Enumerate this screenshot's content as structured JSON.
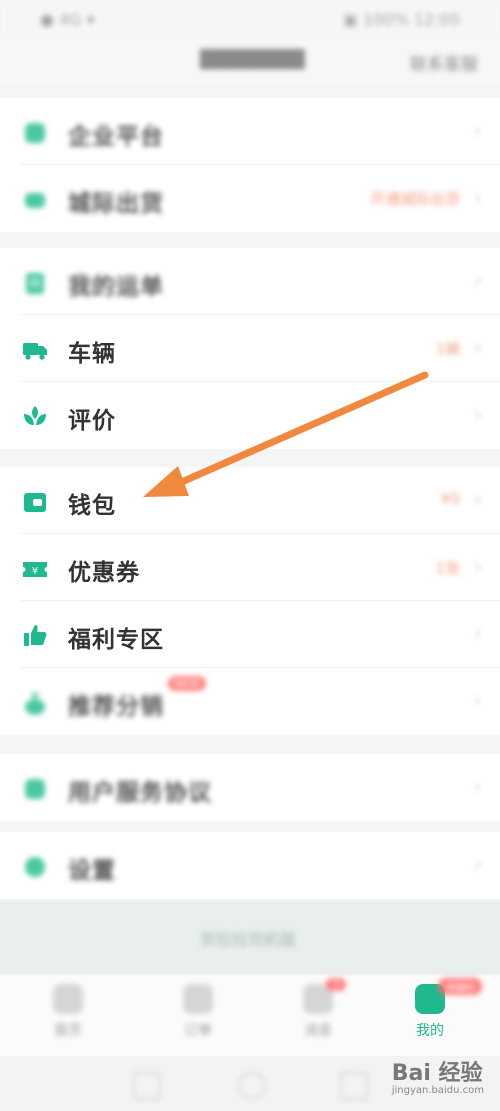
{
  "status_bar": {
    "left": "● 4G ▾",
    "right": "▣ 100% 12:00"
  },
  "header": {
    "title": "████████",
    "right_action": "联系客服"
  },
  "sections": [
    [
      {
        "id": "enterprise",
        "label": "企业平台",
        "value": "",
        "icon": "shield-icon",
        "blurred": true
      },
      {
        "id": "city",
        "label": "城际出货",
        "value": "开通城际出货",
        "icon": "city-icon",
        "blurred": true
      }
    ],
    [
      {
        "id": "orders",
        "label": "我的运单",
        "value": "",
        "icon": "clipboard-icon",
        "blurred": true
      },
      {
        "id": "vehicle",
        "label": "车辆",
        "value": "1辆",
        "icon": "truck-icon",
        "blurred": false
      },
      {
        "id": "review",
        "label": "评价",
        "value": "",
        "icon": "leaf-icon",
        "blurred": false
      }
    ],
    [
      {
        "id": "wallet",
        "label": "钱包",
        "value": "¥0",
        "icon": "wallet-icon",
        "blurred": false
      },
      {
        "id": "coupon",
        "label": "优惠券",
        "value": "1张",
        "icon": "coupon-icon",
        "blurred": false
      },
      {
        "id": "welfare",
        "label": "福利专区",
        "value": "",
        "icon": "thumbs-up-icon",
        "blurred": false
      },
      {
        "id": "referral",
        "label": "推荐分销",
        "value": "",
        "icon": "money-bag-icon",
        "blurred": true,
        "badge": "NEW"
      }
    ],
    [
      {
        "id": "safety",
        "label": "用户服务协议",
        "value": "",
        "icon": "doc-icon",
        "blurred": true
      }
    ],
    [
      {
        "id": "settings",
        "label": "设置",
        "value": "",
        "icon": "gear-icon",
        "blurred": true
      }
    ]
  ],
  "promo_text": "货拉拉司机版",
  "tabs": [
    {
      "label": "首页",
      "active": false,
      "icon": "home-icon"
    },
    {
      "label": "订单",
      "active": false,
      "icon": "order-icon"
    },
    {
      "label": "消息",
      "active": false,
      "icon": "message-icon",
      "badge": "3"
    },
    {
      "label": "我的",
      "active": true,
      "icon": "profile-icon",
      "badge": "领福利"
    }
  ],
  "watermark": {
    "brand": "Bai 经验",
    "url": "jingyan.baidu.com"
  },
  "colors": {
    "accent": "#1fb88f",
    "arrow": "#f0883e",
    "badge": "#ff6b6b",
    "value": "#ea8f6d"
  }
}
